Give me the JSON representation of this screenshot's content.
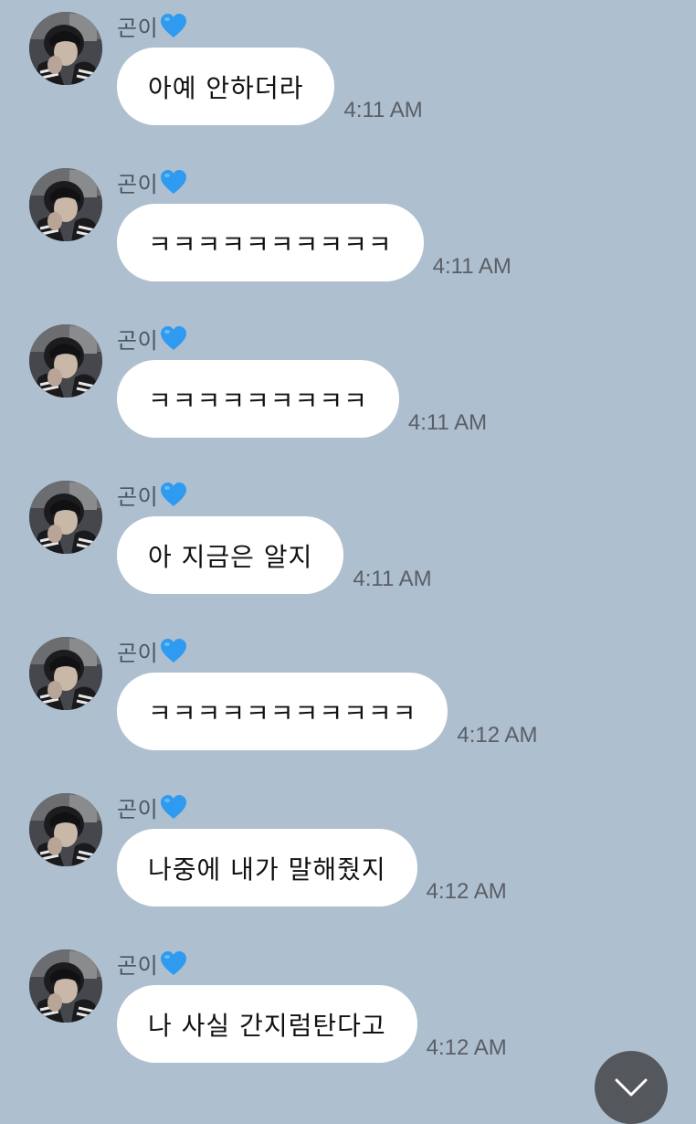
{
  "theme": {
    "background": "#aebfcf",
    "bubble": "#ffffff",
    "heart": "#2e9bf0"
  },
  "contact": {
    "name": "곤이",
    "name_icon": "blue-heart-icon"
  },
  "messages": [
    {
      "sender": "곤이",
      "text": "아예 안하더라",
      "time": "4:11 AM"
    },
    {
      "sender": "곤이",
      "text": "ㅋㅋㅋㅋㅋㅋㅋㅋㅋㅋ",
      "time": "4:11 AM"
    },
    {
      "sender": "곤이",
      "text": "ㅋㅋㅋㅋㅋㅋㅋㅋㅋ",
      "time": "4:11 AM"
    },
    {
      "sender": "곤이",
      "text": "아 지금은 알지",
      "time": "4:11 AM"
    },
    {
      "sender": "곤이",
      "text": "ㅋㅋㅋㅋㅋㅋㅋㅋㅋㅋㅋ",
      "time": "4:12 AM"
    },
    {
      "sender": "곤이",
      "text": "나중에 내가 말해줬지",
      "time": "4:12 AM"
    },
    {
      "sender": "곤이",
      "text": "나 사실 간지럼탄다고",
      "time": "4:12 AM"
    }
  ],
  "controls": {
    "scroll_down_icon": "chevron-down-icon"
  }
}
